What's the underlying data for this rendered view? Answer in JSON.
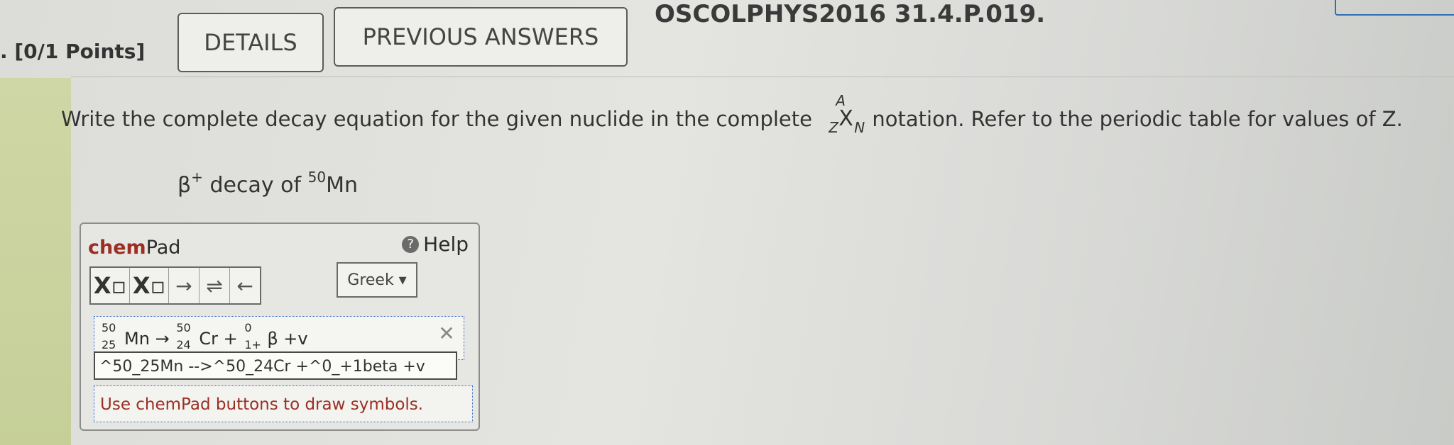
{
  "header": {
    "points": ". [0/1 Points]",
    "details_label": "DETAILS",
    "previous_answers_label": "PREVIOUS ANSWERS",
    "question_id": "OSCOLPHYS2016 31.4.P.019."
  },
  "question": {
    "text_before": "Write the complete decay equation for the given nuclide in the complete",
    "notation_a": "A",
    "notation_z": "Z",
    "notation_x": "X",
    "notation_n": "N",
    "text_after": "notation. Refer to the periodic table for values of Z.",
    "decay_prefix": "β",
    "decay_sup": "+",
    "decay_text": "decay of",
    "mass_number": "50",
    "element": "Mn"
  },
  "chempad": {
    "title_chem": "chem",
    "title_pad": "Pad",
    "help_label": "Help",
    "help_icon_char": "?",
    "toolbar": [
      {
        "name": "subscript-button",
        "label": "X▫"
      },
      {
        "name": "superscript-button",
        "label": "X▫"
      },
      {
        "name": "arrow-right-button",
        "label": "→"
      },
      {
        "name": "equilibrium-button",
        "label": "⇌"
      },
      {
        "name": "arrow-left-button",
        "label": "←"
      }
    ],
    "greek_label": "Greek ▾",
    "equation_display": {
      "mn_top": "50",
      "mn_bottom": "25",
      "mn_symbol": "Mn",
      "arrow": "→",
      "cr_top": "50",
      "cr_bottom": "24",
      "cr_symbol": "Cr +",
      "beta_top": "0",
      "beta_bottom": "1+",
      "beta_symbol": "β +v"
    },
    "clear_icon": "✕",
    "input_value": "^50_25Mn -->^50_24Cr +^0_+1beta +v",
    "hint": "Use chemPad buttons to draw symbols."
  }
}
